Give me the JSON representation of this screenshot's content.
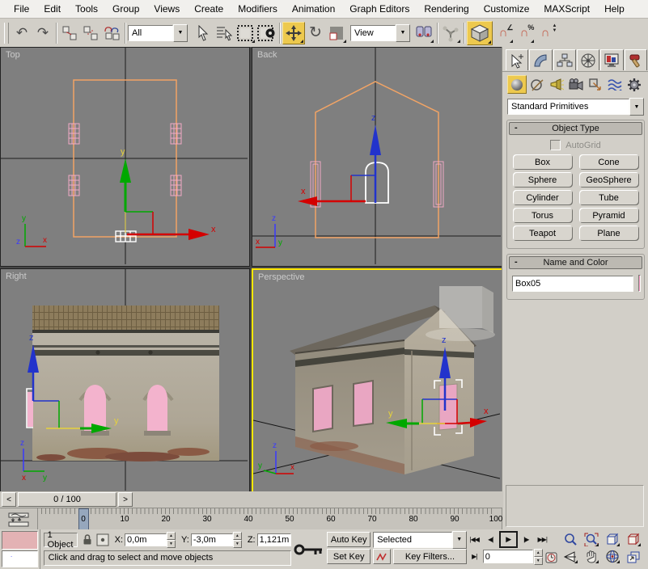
{
  "menu": {
    "items": [
      "File",
      "Edit",
      "Tools",
      "Group",
      "Views",
      "Create",
      "Modifiers",
      "Animation",
      "Graph Editors",
      "Rendering",
      "Customize",
      "MAXScript",
      "Help"
    ]
  },
  "toolbar": {
    "selection_filter_value": "All",
    "coord_system_value": "View",
    "icon_names": [
      "undo-icon",
      "redo-icon",
      "select-and-link-icon",
      "unlink-selection-icon",
      "bind-to-space-warp-icon",
      "selection-filter-dropdown",
      "select-object-icon",
      "select-by-name-icon",
      "rectangular-selection-region-icon",
      "window-crossing-icon",
      "select-and-move-icon",
      "select-and-rotate-icon",
      "select-and-scale-icon",
      "reference-coordinate-system-dropdown",
      "use-pivot-point-center-icon",
      "select-and-manipulate-icon",
      "snap-toggle-icon",
      "angle-snap-icon",
      "percent-snap-icon",
      "spinner-snap-icon"
    ]
  },
  "icons": {
    "undo": "↶",
    "redo": "↷",
    "rotate": "↻",
    "dropdown": "▼",
    "magnet": "∩",
    "angle": "∠",
    "snap3": "3",
    "percent": "%",
    "spin_up": "▲",
    "spin_down": "▼",
    "go_start": "|◀◀",
    "prev_frame": "◀|",
    "play": "▶",
    "next_frame": "|▶",
    "go_end": "▶▶|",
    "key_mode": "▶|",
    "collapse": "-"
  },
  "viewports": {
    "top_label": "Top",
    "back_label": "Back",
    "right_label": "Right",
    "perspective_label": "Perspective",
    "axis": {
      "x": "x",
      "y": "y",
      "z": "z"
    }
  },
  "time_slider": {
    "value": "0 / 100",
    "prev": "<",
    "next": ">"
  },
  "trackbar": {
    "ticks": [
      "0",
      "10",
      "20",
      "30",
      "40",
      "50",
      "60",
      "70",
      "80",
      "90",
      "100"
    ]
  },
  "command_panel": {
    "tab_names": [
      "create-tab",
      "modify-tab",
      "hierarchy-tab",
      "motion-tab",
      "display-tab",
      "utilities-tab"
    ],
    "category_names": [
      "geometry-category",
      "shapes-category",
      "lights-category",
      "cameras-category",
      "helpers-category",
      "spacewarps-category",
      "systems-category"
    ],
    "dropdown_value": "Standard Primitives",
    "rollouts": {
      "object_type": {
        "title": "Object Type",
        "autogrid_label": "AutoGrid",
        "buttons": [
          "Box",
          "Cone",
          "Sphere",
          "GeoSphere",
          "Cylinder",
          "Tube",
          "Torus",
          "Pyramid",
          "Teapot",
          "Plane"
        ]
      },
      "name_color": {
        "title": "Name and Color",
        "object_name": "Box05",
        "swatch_color": "#ef93bb"
      }
    }
  },
  "status_bar": {
    "object_count": "1 Object",
    "x_label": "X:",
    "x_value": "0,0m",
    "y_label": "Y:",
    "y_value": "-3,0m",
    "z_label": "Z:",
    "z_value": "1,121m",
    "prompt": "Click and drag to select and move objects",
    "auto_key_label": "Auto Key",
    "set_key_label": "Set Key",
    "key_mode_value": "Selected",
    "key_filters_label": "Key Filters...",
    "frame_value": "0"
  },
  "colors": {
    "active_tool_highlight": "#edc94e",
    "active_viewport_border": "#ffe800",
    "wireframe_orange": "#f2a465",
    "object_pink": "#f2aac6",
    "name_swatch": "#ef93bb",
    "viewport_background": "#7f7f7f"
  }
}
